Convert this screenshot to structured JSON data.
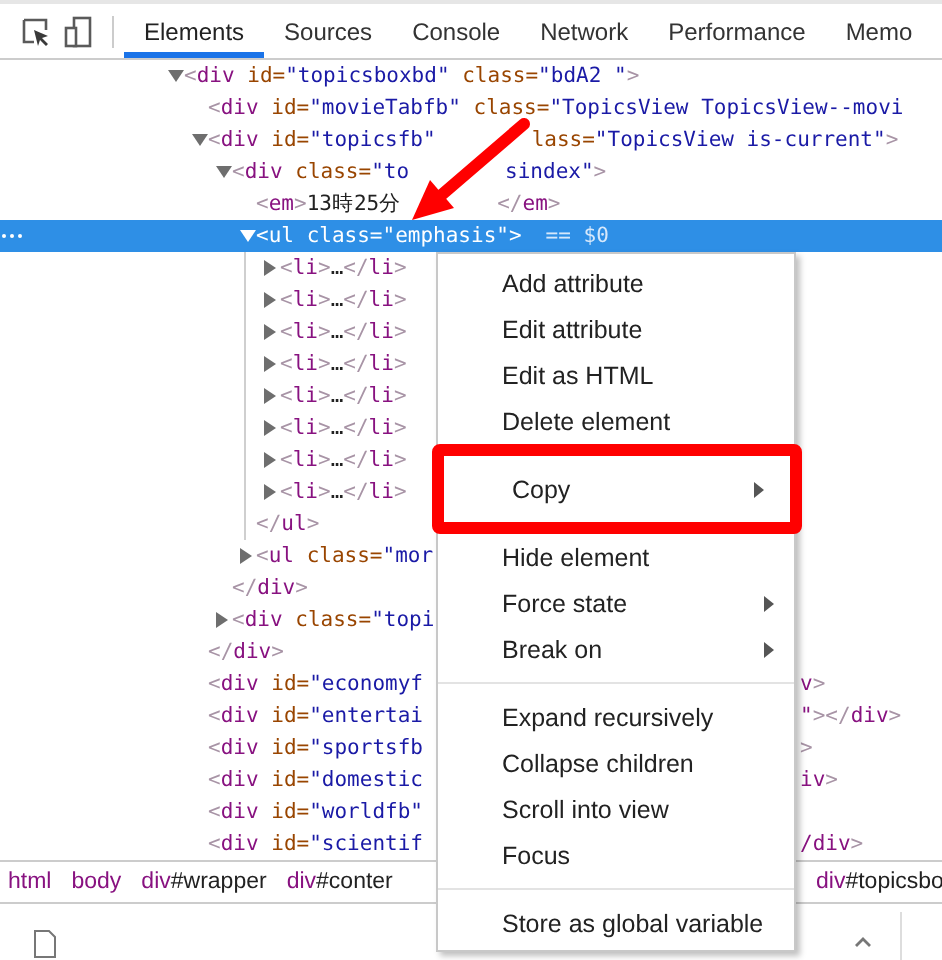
{
  "toolbar": {
    "tabs": [
      {
        "label": "Elements",
        "selected": true
      },
      {
        "label": "Sources",
        "selected": false
      },
      {
        "label": "Console",
        "selected": false
      },
      {
        "label": "Network",
        "selected": false
      },
      {
        "label": "Performance",
        "selected": false
      },
      {
        "label": "Memo",
        "selected": false
      }
    ]
  },
  "dom_tree": [
    {
      "text": "<div id=\"topicsboxbd\" class=\"bdA2 \">",
      "expanded": true,
      "selected": false,
      "children": [
        {
          "text": "<div id=\"movieTabfb\" class=\"TopicsView TopicsView--movi",
          "selected": false
        },
        {
          "text": "<div id=\"topicsfb\"",
          "text_2": "lass=\"TopicsView is-current\">",
          "expanded": true,
          "selected": false,
          "children": [
            {
              "text": "<div class=\"to",
              "text_2": "sindex\">",
              "expanded": true,
              "selected": false,
              "children": [
                {
                  "text": "<em>13時25分",
                  "text_2": "</em>",
                  "selected": false
                },
                {
                  "text": "<ul class=\"emphasis\">",
                  "suffix": "== $0",
                  "expanded": true,
                  "selected": true,
                  "children": [
                    {
                      "text": "<li>…</li>",
                      "expanded": false,
                      "selected": false
                    },
                    {
                      "text": "<li>…</li>",
                      "expanded": false,
                      "selected": false
                    },
                    {
                      "text": "<li>…</li>",
                      "expanded": false,
                      "selected": false
                    },
                    {
                      "text": "<li>…</li>",
                      "expanded": false,
                      "selected": false
                    },
                    {
                      "text": "<li>…</li>",
                      "expanded": false,
                      "selected": false
                    },
                    {
                      "text": "<li>…</li>",
                      "expanded": false,
                      "selected": false
                    },
                    {
                      "text": "<li>…</li>",
                      "expanded": false,
                      "selected": false
                    },
                    {
                      "text": "<li>…</li>",
                      "expanded": false,
                      "selected": false
                    }
                  ],
                  "closing": "</ul>"
                },
                {
                  "text": "<ul class=\"mor",
                  "expanded": false,
                  "selected": false
                }
              ],
              "closing": "</div>"
            },
            {
              "text": "<div class=\"topi",
              "expanded": false,
              "selected": false
            }
          ],
          "closing": "</div>"
        },
        {
          "text": "<div id=\"economyf",
          "text_right": "v>",
          "selected": false
        },
        {
          "text": "<div id=\"entertai",
          "text_right": "\"></div>",
          "selected": false
        },
        {
          "text": "<div id=\"sportsfb",
          "text_right": ">",
          "selected": false
        },
        {
          "text": "<div id=\"domestic",
          "text_right": "iv>",
          "selected": false
        },
        {
          "text": "<div id=\"worldfb\"",
          "selected": false
        },
        {
          "text": "<div id=\"scientif",
          "text_right": "/div>",
          "selected": false
        }
      ]
    }
  ],
  "breadcrumbs": [
    {
      "tag": "html"
    },
    {
      "tag": "body"
    },
    {
      "tag": "div",
      "id": "#wrapper"
    },
    {
      "tag": "div",
      "id": "#conter"
    }
  ],
  "breadcrumbs_past_menu": [
    {
      "tag": "div",
      "id": "#topicsbo"
    }
  ],
  "context_menu": {
    "items": [
      {
        "kind": "item",
        "label": "Add attribute",
        "submenu": false,
        "boxed": false
      },
      {
        "kind": "item",
        "label": "Edit attribute",
        "submenu": false,
        "boxed": false
      },
      {
        "kind": "item",
        "label": "Edit as HTML",
        "submenu": false,
        "boxed": false
      },
      {
        "kind": "item",
        "label": "Delete element",
        "submenu": false,
        "boxed": false
      },
      {
        "kind": "item",
        "label": "Copy",
        "submenu": true,
        "boxed": true
      },
      {
        "kind": "item",
        "label": "Hide element",
        "submenu": false,
        "boxed": false
      },
      {
        "kind": "item",
        "label": "Force state",
        "submenu": true,
        "boxed": false
      },
      {
        "kind": "item",
        "label": "Break on",
        "submenu": true,
        "boxed": false
      },
      {
        "kind": "separator"
      },
      {
        "kind": "item",
        "label": "Expand recursively",
        "submenu": false,
        "boxed": false
      },
      {
        "kind": "item",
        "label": "Collapse children",
        "submenu": false,
        "boxed": false
      },
      {
        "kind": "item",
        "label": "Scroll into view",
        "submenu": false,
        "boxed": false
      },
      {
        "kind": "item",
        "label": "Focus",
        "submenu": false,
        "boxed": false
      },
      {
        "kind": "separator"
      },
      {
        "kind": "item",
        "label": "Store as global variable",
        "submenu": false,
        "boxed": false
      }
    ]
  }
}
